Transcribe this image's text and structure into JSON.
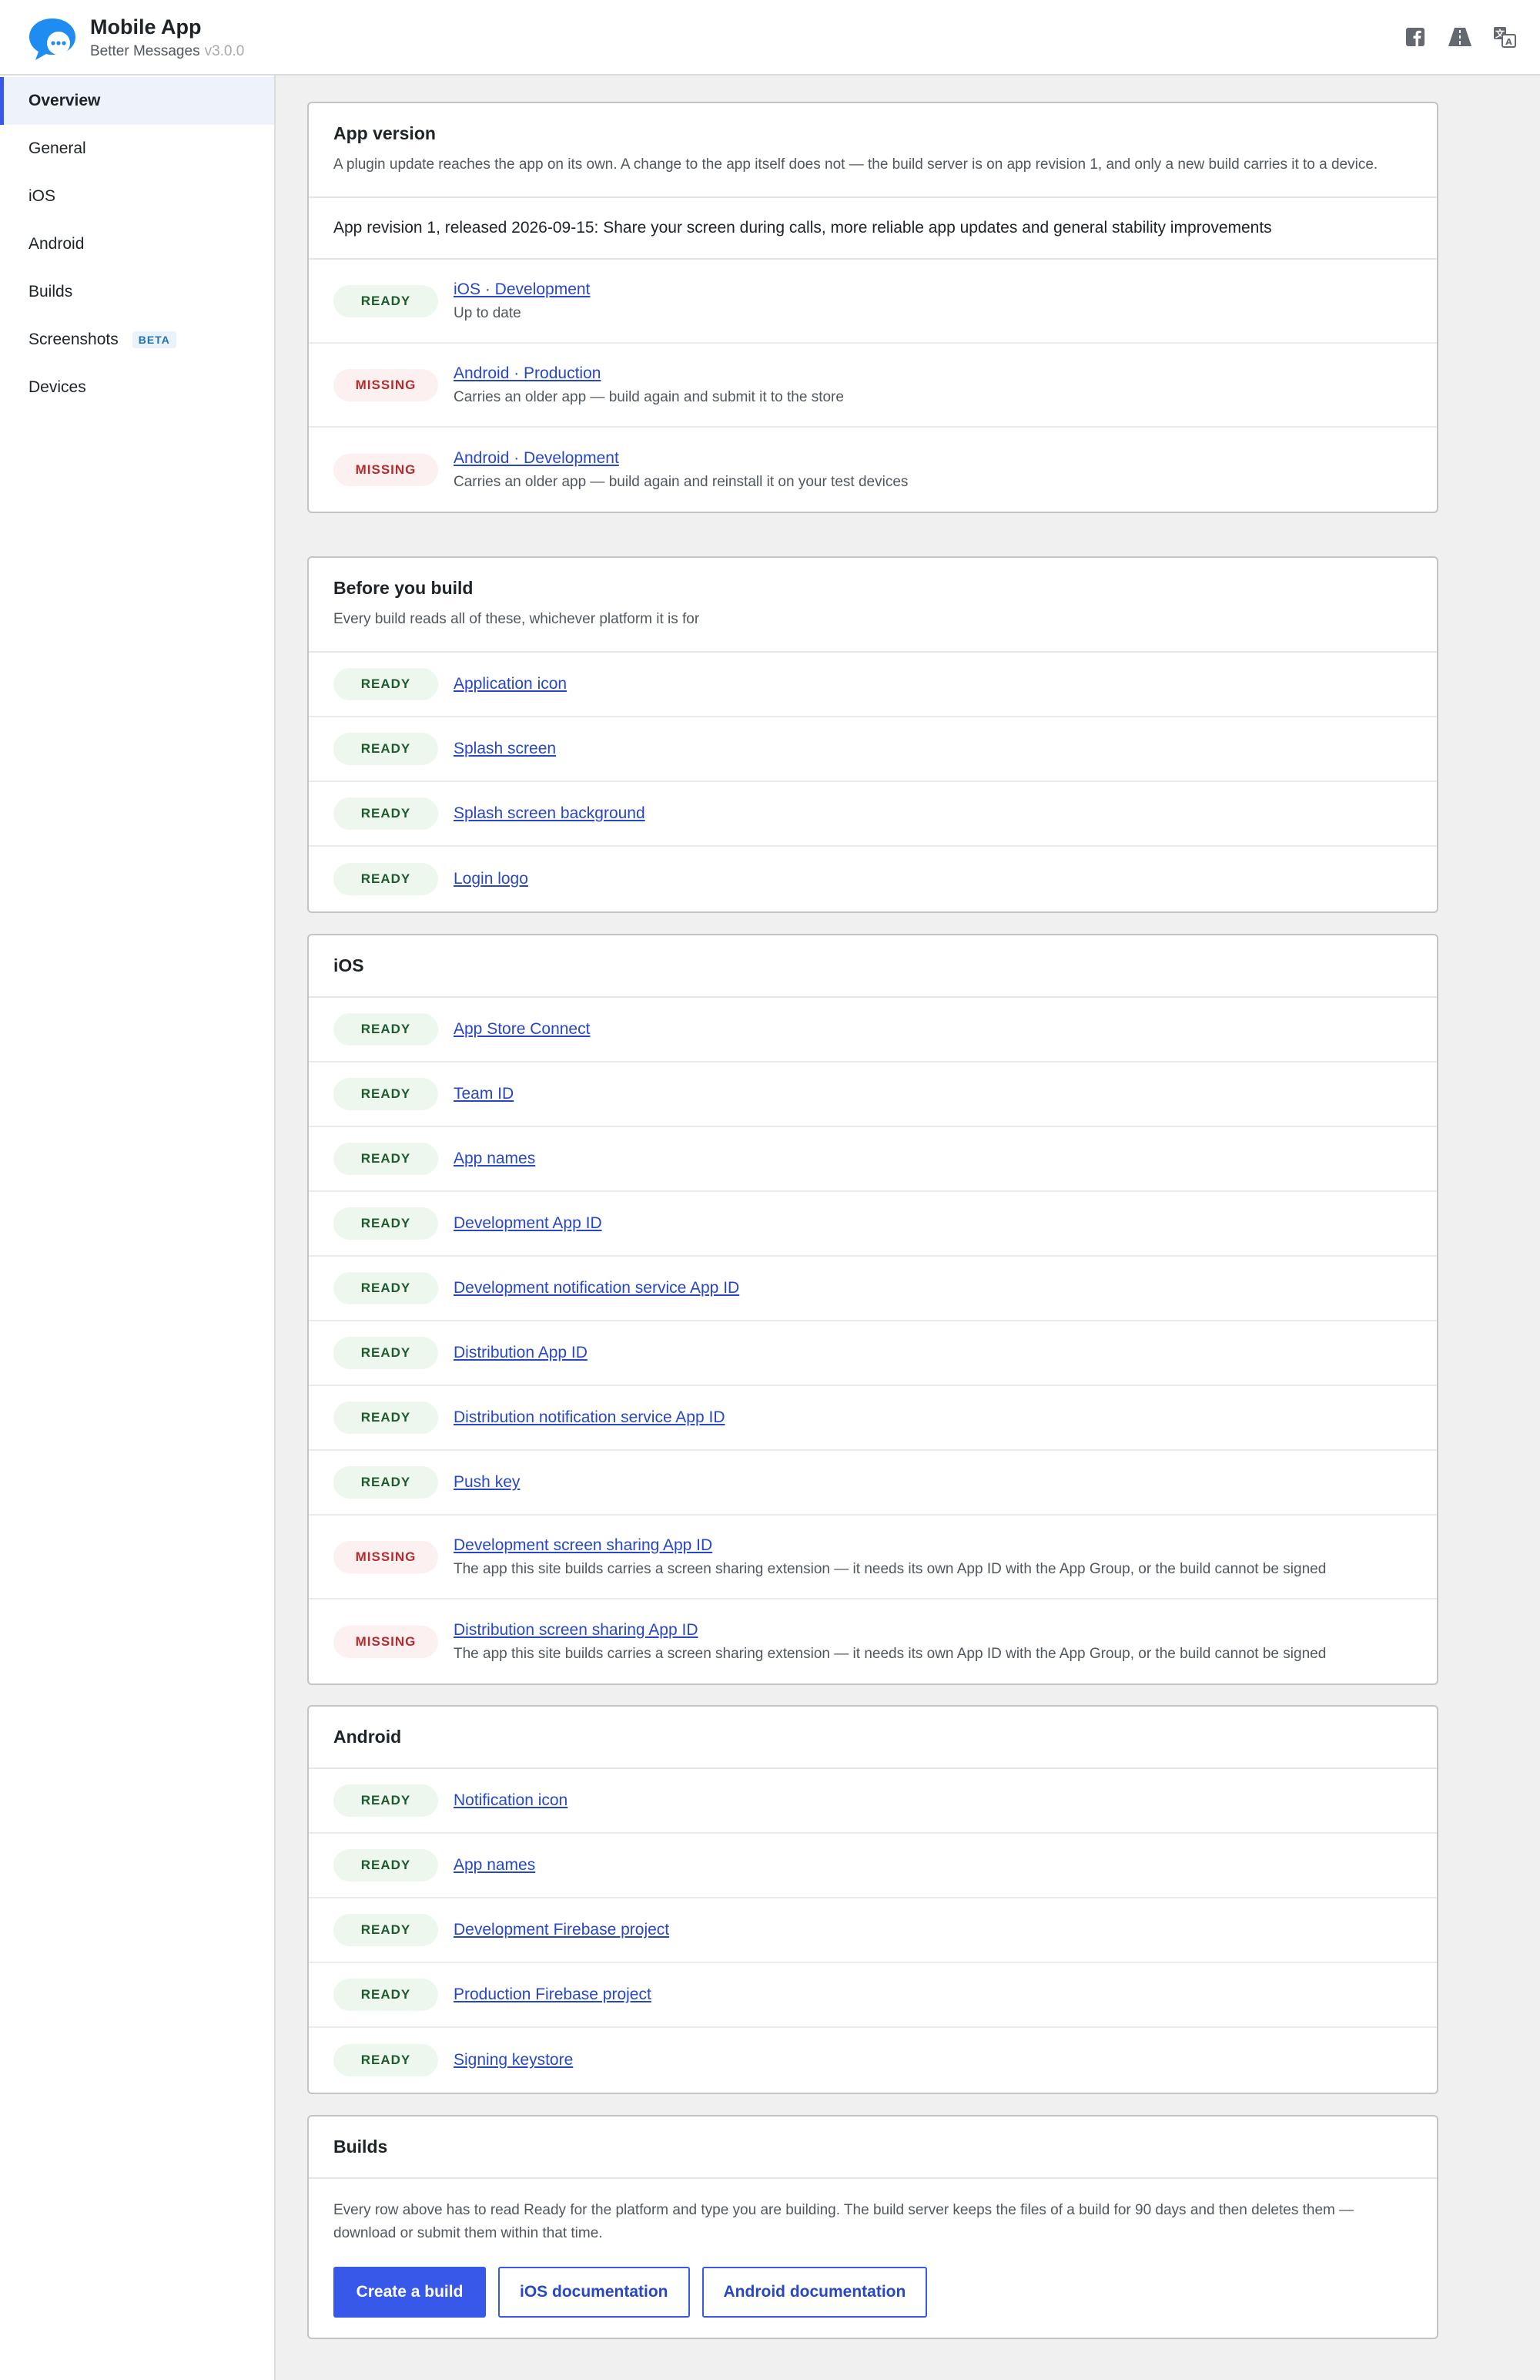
{
  "header": {
    "title": "Mobile App",
    "subtitle": "Better Messages",
    "version": "v3.0.0",
    "icons": [
      "facebook-icon",
      "road-icon",
      "translate-icon"
    ]
  },
  "colors": {
    "accent": "#3858e9",
    "ready_bg": "#edf7ee",
    "ready_text": "#1e5a2c",
    "missing_bg": "#fcf0f1",
    "missing_text": "#b32d2e",
    "link": "#2746c8"
  },
  "sidebar": {
    "items": [
      {
        "label": "Overview",
        "active": true
      },
      {
        "label": "General"
      },
      {
        "label": "iOS"
      },
      {
        "label": "Android"
      },
      {
        "label": "Builds"
      },
      {
        "label": "Screenshots",
        "badge": "BETA"
      },
      {
        "label": "Devices"
      }
    ]
  },
  "app_version": {
    "title": "App version",
    "description": "A plugin update reaches the app on its own. A change to the app itself does not — the build server is on app revision 1, and only a new build carries it to a device.",
    "revision": "App revision 1, released 2026-09-15: Share your screen during calls, more reliable app updates and general stability improvements",
    "rows": [
      {
        "status": "READY",
        "kind": "ready",
        "label": "iOS · Development",
        "desc": "Up to date"
      },
      {
        "status": "MISSING",
        "kind": "missing",
        "label": "Android · Production",
        "desc": "Carries an older app — build again and submit it to the store"
      },
      {
        "status": "MISSING",
        "kind": "missing",
        "label": "Android · Development",
        "desc": "Carries an older app — build again and reinstall it on your test devices"
      }
    ]
  },
  "before_build": {
    "title": "Before you build",
    "description": "Every build reads all of these, whichever platform it is for",
    "rows": [
      {
        "status": "READY",
        "label": "Application icon"
      },
      {
        "status": "READY",
        "label": "Splash screen"
      },
      {
        "status": "READY",
        "label": "Splash screen background"
      },
      {
        "status": "READY",
        "label": "Login logo"
      }
    ]
  },
  "ios": {
    "title": "iOS",
    "rows": [
      {
        "status": "READY",
        "label": "App Store Connect"
      },
      {
        "status": "READY",
        "label": "Team ID"
      },
      {
        "status": "READY",
        "label": "App names"
      },
      {
        "status": "READY",
        "label": "Development App ID"
      },
      {
        "status": "READY",
        "label": "Development notification service App ID"
      },
      {
        "status": "READY",
        "label": "Distribution App ID"
      },
      {
        "status": "READY",
        "label": "Distribution notification service App ID"
      },
      {
        "status": "READY",
        "label": "Push key"
      },
      {
        "status": "MISSING",
        "label": "Development screen sharing App ID",
        "desc": "The app this site builds carries a screen sharing extension — it needs its own App ID with the App Group, or the build cannot be signed"
      },
      {
        "status": "MISSING",
        "label": "Distribution screen sharing App ID",
        "desc": "The app this site builds carries a screen sharing extension — it needs its own App ID with the App Group, or the build cannot be signed"
      }
    ]
  },
  "android": {
    "title": "Android",
    "rows": [
      {
        "status": "READY",
        "label": "Notification icon"
      },
      {
        "status": "READY",
        "label": "App names"
      },
      {
        "status": "READY",
        "label": "Development Firebase project"
      },
      {
        "status": "READY",
        "label": "Production Firebase project"
      },
      {
        "status": "READY",
        "label": "Signing keystore"
      }
    ]
  },
  "builds": {
    "title": "Builds",
    "description": "Every row above has to read Ready for the platform and type you are building. The build server keeps the files of a build for 90 days and then deletes them — download or submit them within that time.",
    "create_label": "Create a build",
    "ios_docs_label": "iOS documentation",
    "android_docs_label": "Android documentation"
  }
}
